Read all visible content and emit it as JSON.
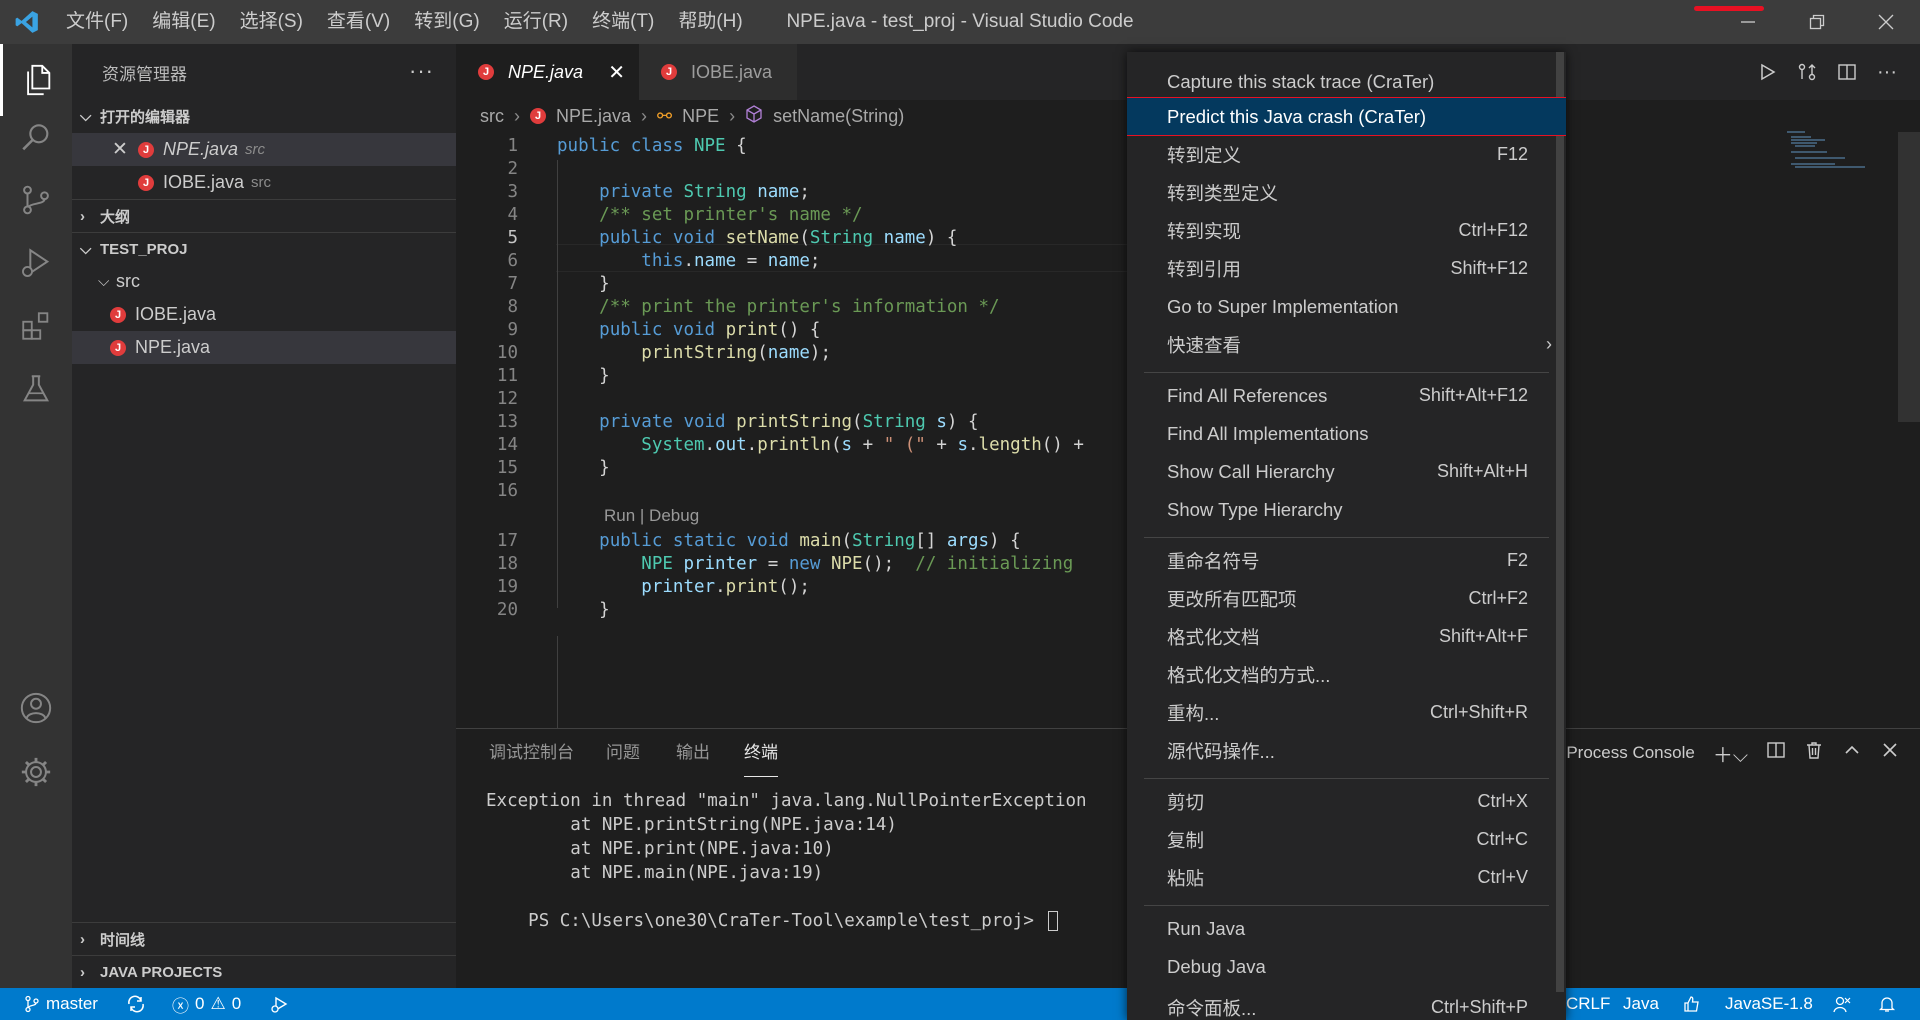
{
  "window": {
    "title": "NPE.java - test_proj - Visual Studio Code",
    "menu": [
      "文件(F)",
      "编辑(E)",
      "选择(S)",
      "查看(V)",
      "转到(G)",
      "运行(R)",
      "终端(T)",
      "帮助(H)"
    ]
  },
  "sidebar": {
    "title": "资源管理器",
    "more": "···",
    "open_editors_header": "打开的编辑器",
    "open_editors": [
      {
        "name": "NPE.java",
        "desc": "src"
      },
      {
        "name": "IOBE.java",
        "desc": "src"
      }
    ],
    "outline_header": "大纲",
    "project_header": "TEST_PROJ",
    "folder": "src",
    "files": [
      "IOBE.java",
      "NPE.java"
    ],
    "timeline_header": "时间线",
    "java_projects_header": "JAVA PROJECTS",
    "jicon_letter": "J"
  },
  "tabs": [
    {
      "label": "NPE.java",
      "close": "✕"
    },
    {
      "label": "IOBE.java"
    }
  ],
  "breadcrumb": {
    "src": "src",
    "file": "NPE.java",
    "class": "NPE",
    "method": "setName(String)"
  },
  "code": {
    "line_numbers": [
      "1",
      "2",
      "3",
      "4",
      "5",
      "6",
      "7",
      "8",
      "9",
      "10",
      "11",
      "12",
      "13",
      "14",
      "15",
      "16",
      "17",
      "18",
      "19",
      "20"
    ],
    "codelens": "Run | Debug"
  },
  "panel": {
    "tabs": [
      "调试控制台",
      "问题",
      "输出",
      "终端"
    ],
    "process": "Process Console",
    "terminal_lines": [
      "Exception in thread \"main\" java.lang.NullPointerException",
      "        at NPE.printString(NPE.java:14)",
      "        at NPE.print(NPE.java:10)",
      "        at NPE.main(NPE.java:19)",
      "PS C:\\Users\\one30\\CraTer-Tool\\example\\test_proj> "
    ]
  },
  "statusbar": {
    "branch": "master",
    "errors": "0",
    "warnings": "0",
    "eol": "CRLF",
    "language": "Java",
    "jdk": "JavaSE-1.8"
  },
  "context_menu": {
    "items": [
      {
        "label": "Capture this stack trace (CraTer)",
        "kb": ""
      },
      {
        "label": "Predict this Java crash (CraTer)",
        "kb": ""
      },
      {
        "label": "转到定义",
        "kb": "F12"
      },
      {
        "label": "转到类型定义",
        "kb": ""
      },
      {
        "label": "转到实现",
        "kb": "Ctrl+F12"
      },
      {
        "label": "转到引用",
        "kb": "Shift+F12"
      },
      {
        "label": "Go to Super Implementation",
        "kb": ""
      },
      {
        "label": "快速查看",
        "kb": ""
      },
      {
        "label": "Find All References",
        "kb": "Shift+Alt+F12"
      },
      {
        "label": "Find All Implementations",
        "kb": ""
      },
      {
        "label": "Show Call Hierarchy",
        "kb": "Shift+Alt+H"
      },
      {
        "label": "Show Type Hierarchy",
        "kb": ""
      },
      {
        "label": "重命名符号",
        "kb": "F2"
      },
      {
        "label": "更改所有匹配项",
        "kb": "Ctrl+F2"
      },
      {
        "label": "格式化文档",
        "kb": "Shift+Alt+F"
      },
      {
        "label": "格式化文档的方式...",
        "kb": ""
      },
      {
        "label": "重构...",
        "kb": "Ctrl+Shift+R"
      },
      {
        "label": "源代码操作...",
        "kb": ""
      },
      {
        "label": "剪切",
        "kb": "Ctrl+X"
      },
      {
        "label": "复制",
        "kb": "Ctrl+C"
      },
      {
        "label": "粘贴",
        "kb": "Ctrl+V"
      },
      {
        "label": "Run Java",
        "kb": ""
      },
      {
        "label": "Debug Java",
        "kb": ""
      },
      {
        "label": "命令面板...",
        "kb": "Ctrl+Shift+P"
      }
    ]
  }
}
